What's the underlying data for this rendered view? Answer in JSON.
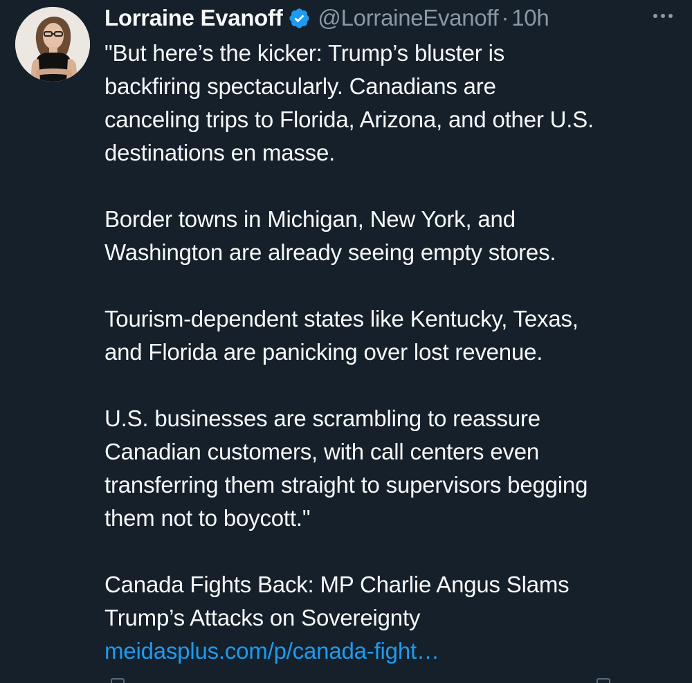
{
  "tweet": {
    "author": {
      "display_name": "Lorraine Evanoff",
      "handle": "@LorraineEvanoff",
      "verified": true
    },
    "separator": "·",
    "time": "10h",
    "paragraphs": [
      [
        "\"But here’s the kicker: Trump’s bluster is",
        "backfiring spectacularly.  Canadians are",
        "canceling trips to Florida, Arizona, and other U.S.",
        "destinations en masse."
      ],
      [
        "Border towns in Michigan, New York, and",
        "Washington are already seeing empty stores."
      ],
      [
        "Tourism-dependent states  like Kentucky, Texas,",
        "and Florida are panicking over lost revenue."
      ],
      [
        "U.S. businesses are scrambling to reassure",
        "Canadian customers, with call centers even",
        "transferring them straight to supervisors begging",
        "them not to boycott.\""
      ]
    ],
    "link_card_text": [
      "Canada Fights Back: MP Charlie Angus Slams",
      "Trump’s Attacks on Sovereignty"
    ],
    "link_url": "meidasplus.com/p/canada-fight…"
  },
  "colors": {
    "background": "#15202b",
    "text": "#f7f9f9",
    "secondary": "#8b98a5",
    "accent": "#1d9bf0"
  },
  "icons": {
    "verified": "verified-badge-icon",
    "more": "more-options-icon"
  }
}
